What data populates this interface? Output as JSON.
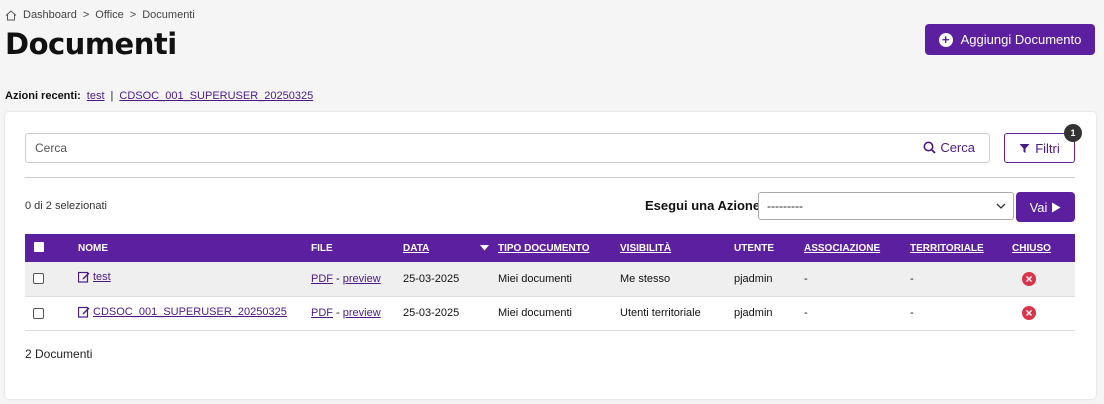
{
  "breadcrumb": {
    "items": [
      "Dashboard",
      "Office",
      "Documenti"
    ],
    "separator": ">"
  },
  "page": {
    "title": "Documenti"
  },
  "header": {
    "add_button_label": "Aggiungi Documento"
  },
  "recent": {
    "label": "Azioni recenti",
    "colon": ":",
    "items": [
      "test",
      "CDSOC_001_SUPERUSER_20250325"
    ],
    "separator": "|"
  },
  "search": {
    "placeholder": "Cerca",
    "button_label": "Cerca"
  },
  "filters": {
    "button_label": "Filtri",
    "badge_count": "1"
  },
  "selection": {
    "count_text": "0 di 2 selezionati"
  },
  "actions": {
    "label": "Esegui una Azione:",
    "selected_value": "---------",
    "go_label": "Vai"
  },
  "table": {
    "columns": [
      "NOME",
      "FILE",
      "DATA",
      "TIPO DOCUMENTO",
      "VISIBILITÀ",
      "UTENTE",
      "ASSOCIAZIONE",
      "TERRITORIALE",
      "CHIUSO"
    ],
    "rows": [
      {
        "nome": "test",
        "file_pdf": "PDF",
        "file_sep": " - ",
        "file_preview": "preview",
        "data": "25-03-2025",
        "tipo": "Miei documenti",
        "visibilita": "Me stesso",
        "utente": "pjadmin",
        "associazione": "-",
        "territoriale": "-"
      },
      {
        "nome": "CDSOC_001_SUPERUSER_20250325",
        "file_pdf": "PDF",
        "file_sep": " - ",
        "file_preview": "preview",
        "data": "25-03-2025",
        "tipo": "Miei documenti",
        "visibilita": "Utenti territoriale",
        "utente": "pjadmin",
        "associazione": "-",
        "territoriale": "-"
      }
    ]
  },
  "footer": {
    "count_text": "2 Documenti"
  },
  "colors": {
    "accent": "#5c1fa0",
    "closed": "#d9344a"
  }
}
